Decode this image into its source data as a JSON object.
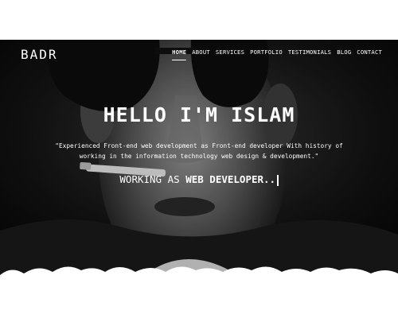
{
  "site": {
    "logo": "BADR"
  },
  "nav": [
    {
      "label": "HOME",
      "active": true
    },
    {
      "label": "ABOUT"
    },
    {
      "label": "SERVICES"
    },
    {
      "label": "PORTFOLIO"
    },
    {
      "label": "TESTIMONIALS"
    },
    {
      "label": "BLOG"
    },
    {
      "label": "CONTACT"
    }
  ],
  "hero": {
    "headline": "HELLO I'M ISLAM",
    "quote_line1": "\"Experienced Front-end web development as Front-end developer With history of",
    "quote_line2": "working in the information technology web design & development.\"",
    "typed_prefix": "WORKING AS ",
    "typed_role": "WEB DEVELOPER..",
    "photo_icon": "portrait-photo"
  },
  "colors": {
    "hero_bg": "#0a0a0a",
    "text": "#ffffff",
    "page_bg": "#ffffff"
  }
}
